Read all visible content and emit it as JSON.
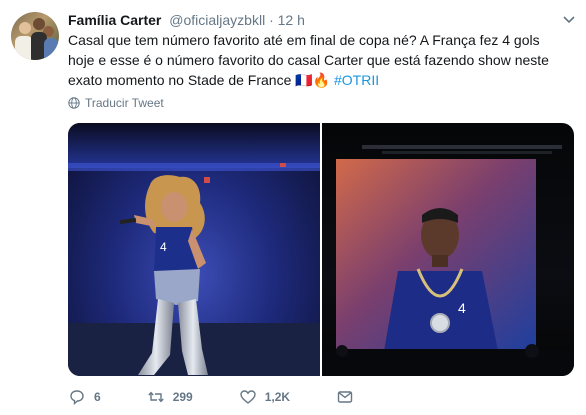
{
  "tweet": {
    "author": {
      "display_name": "Família Carter",
      "handle": "@oficialjayzbkll",
      "separator": "·",
      "time": "12 h"
    },
    "text_main": "Casal que tem número favorito até em final de copa né? A França fez 4 gols hoje e esse é o número favorito do casal Carter que está fazendo show neste exato momento no Stade de France 🇫🇷🔥 ",
    "hashtag": "#OTRII",
    "translate_label": "Traducir Tweet",
    "actions": {
      "replies": "6",
      "retweets": "299",
      "likes": "1,2K"
    }
  },
  "colors": {
    "text": "#14171a",
    "muted": "#657786",
    "link": "#1b95e0"
  },
  "icons": [
    "chevron-down-icon",
    "globe-icon",
    "reply-icon",
    "retweet-icon",
    "like-icon",
    "message-icon"
  ]
}
